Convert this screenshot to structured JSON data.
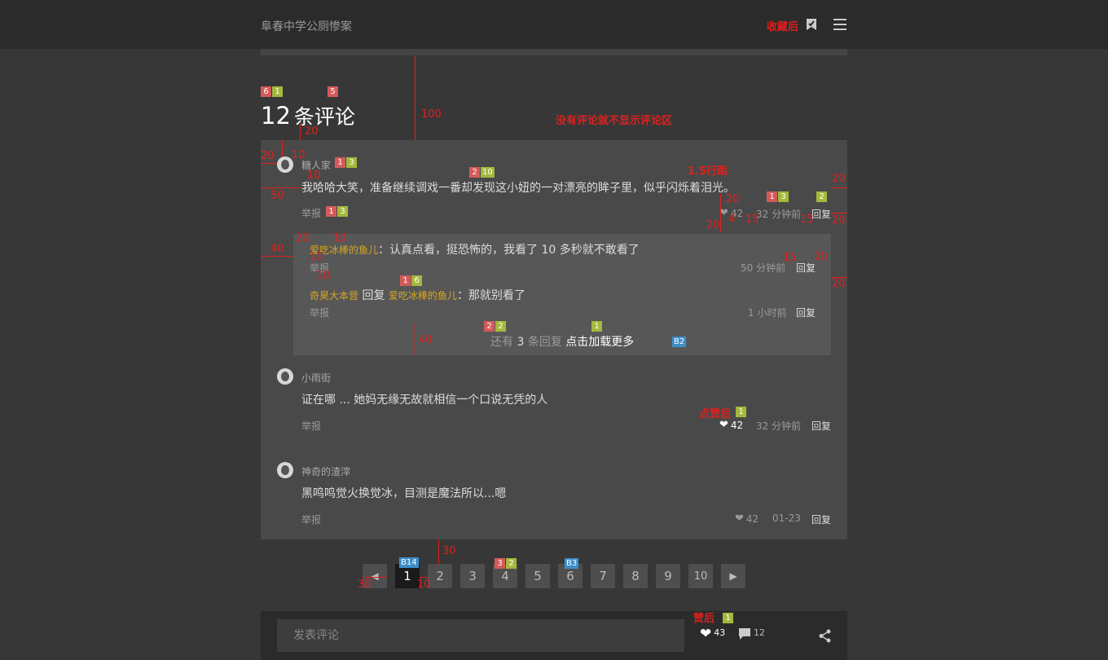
{
  "header": {
    "site_title": "阜春中学公厕惨案",
    "fav_note": "收藏后"
  },
  "comments_section": {
    "count": "12",
    "count_label": "条评论",
    "no_comment_note": "没有评论就不显示评论区"
  },
  "comments": [
    {
      "user": "糖人家",
      "text": "我哈哈大笑，准备继续调戏一番却发现这小妞的一对漂亮的眸子里，似乎闪烁着泪光。",
      "report": "举报",
      "likes": "42",
      "time": "32 分钟前",
      "reply": "回复"
    },
    {
      "user": "小雨街",
      "text": "证在哪 ... 她妈无缘无故就相信一个口说无凭的人",
      "report": "举报",
      "likes": "42",
      "time": "32 分钟前",
      "reply": "回复",
      "like_note": "点赞后"
    },
    {
      "user": "神奇的渣滓",
      "text": "黑鸣鸣觉火换觉冰，目测是魔法所以...嗯",
      "report": "举报",
      "likes": "42",
      "time": "01-23",
      "reply": "回复"
    }
  ],
  "replies": [
    {
      "user": "爱吃冰棒的鱼儿",
      "text": "：认真点看，挺恐怖的，我看了 10 多秒就不敢看了",
      "report": "举报",
      "time": "50 分钟前",
      "reply": "回复"
    },
    {
      "user": "奇昊大本营",
      "reply_word": "回复",
      "target": "爱吃冰棒的鱼儿",
      "text": "：那就别看了",
      "report": "举报",
      "time": "1 小时前",
      "reply": "回复"
    }
  ],
  "load_more": {
    "prefix": "还有",
    "count": "3",
    "suffix": "条回复",
    "link": "点击加载更多"
  },
  "pagination": {
    "pages": [
      "1",
      "2",
      "3",
      "4",
      "5",
      "6",
      "7",
      "8",
      "9",
      "10"
    ],
    "active": "1"
  },
  "bottom_bar": {
    "placeholder": "发表评论",
    "likes": "43",
    "comments": "12",
    "like_note": "赞后"
  },
  "annotations": {
    "labels": [
      "100",
      "20",
      "20",
      "10",
      "50",
      "10",
      "1.5行距",
      "20",
      "20",
      "4",
      "15",
      "15",
      "20",
      "20",
      "40",
      "20",
      "10",
      "10",
      "10",
      "15",
      "20",
      "20",
      "40",
      "30",
      "30",
      "10"
    ],
    "badges": [
      "6",
      "1",
      "5",
      "1",
      "3",
      "2",
      "10",
      "1",
      "3",
      "1",
      "3",
      "2",
      "1",
      "6",
      "2",
      "2",
      "1",
      "B2",
      "1",
      "B14",
      "3",
      "2",
      "B3",
      "1"
    ]
  },
  "colors": {
    "background": "#373737",
    "bar": "#2b2b2b",
    "panel": "#494949",
    "subpanel": "#575757",
    "annotation": "#e0201e",
    "username_highlight": "#d8a820"
  }
}
